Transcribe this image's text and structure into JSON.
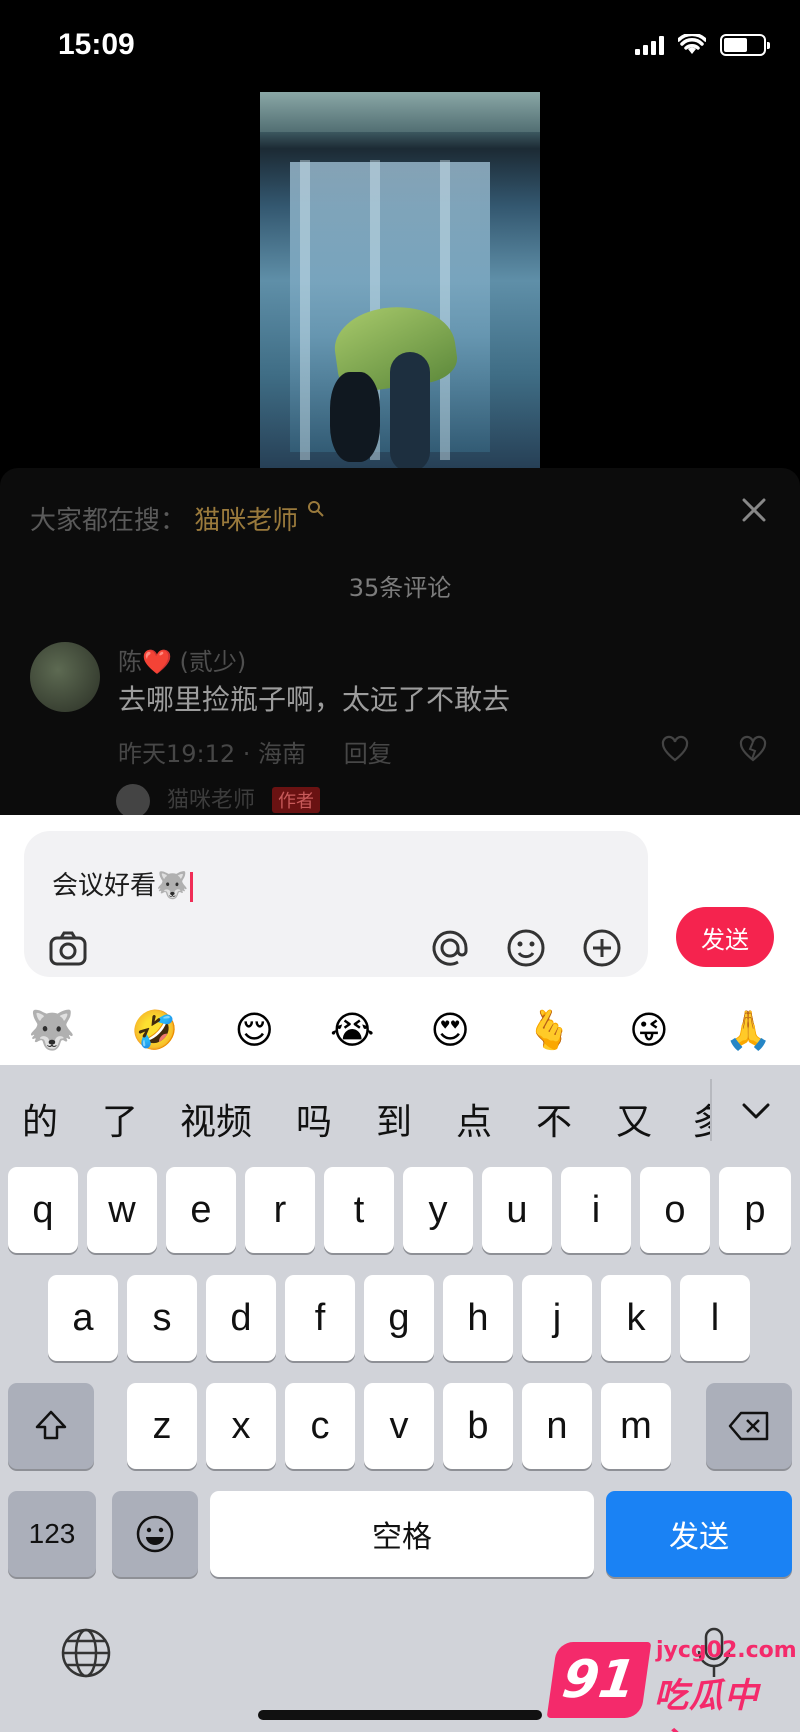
{
  "status_bar": {
    "time": "15:09"
  },
  "video": {
    "alt": "video-frame"
  },
  "comments": {
    "search_label": "大家都在搜：",
    "search_term": "猫咪老师",
    "count_label": "35条评论",
    "items": [
      {
        "user": "陈",
        "user_suffix": "(贰少)",
        "text": "去哪里捡瓶子啊，太远了不敢去",
        "time_location": "昨天19:12 · 海南",
        "reply_label": "回复"
      }
    ],
    "sub_reply": {
      "user": "猫咪老师",
      "badge": "作者"
    }
  },
  "composer": {
    "input_value": "会议好看",
    "send_label": "发送",
    "emojis": [
      "🐺",
      "🤣",
      "😌",
      "😭",
      "😍",
      "🫰",
      "😜",
      "🙏"
    ]
  },
  "keyboard": {
    "candidates": [
      "的",
      "了",
      "视频",
      "吗",
      "到",
      "点",
      "不",
      "又",
      "多"
    ],
    "row1": [
      "q",
      "w",
      "e",
      "r",
      "t",
      "y",
      "u",
      "i",
      "o",
      "p"
    ],
    "row2": [
      "a",
      "s",
      "d",
      "f",
      "g",
      "h",
      "j",
      "k",
      "l"
    ],
    "row3": [
      "z",
      "x",
      "c",
      "v",
      "b",
      "n",
      "m"
    ],
    "numbers_label": "123",
    "space_label": "空格",
    "return_label": "发送"
  },
  "watermark": {
    "logo": "91",
    "domain": "jycg02.com",
    "name": "吃瓜中心"
  },
  "colors": {
    "accent": "#f5234e",
    "return_key": "#1a82f4",
    "keyboard_bg": "#d1d3d9"
  }
}
